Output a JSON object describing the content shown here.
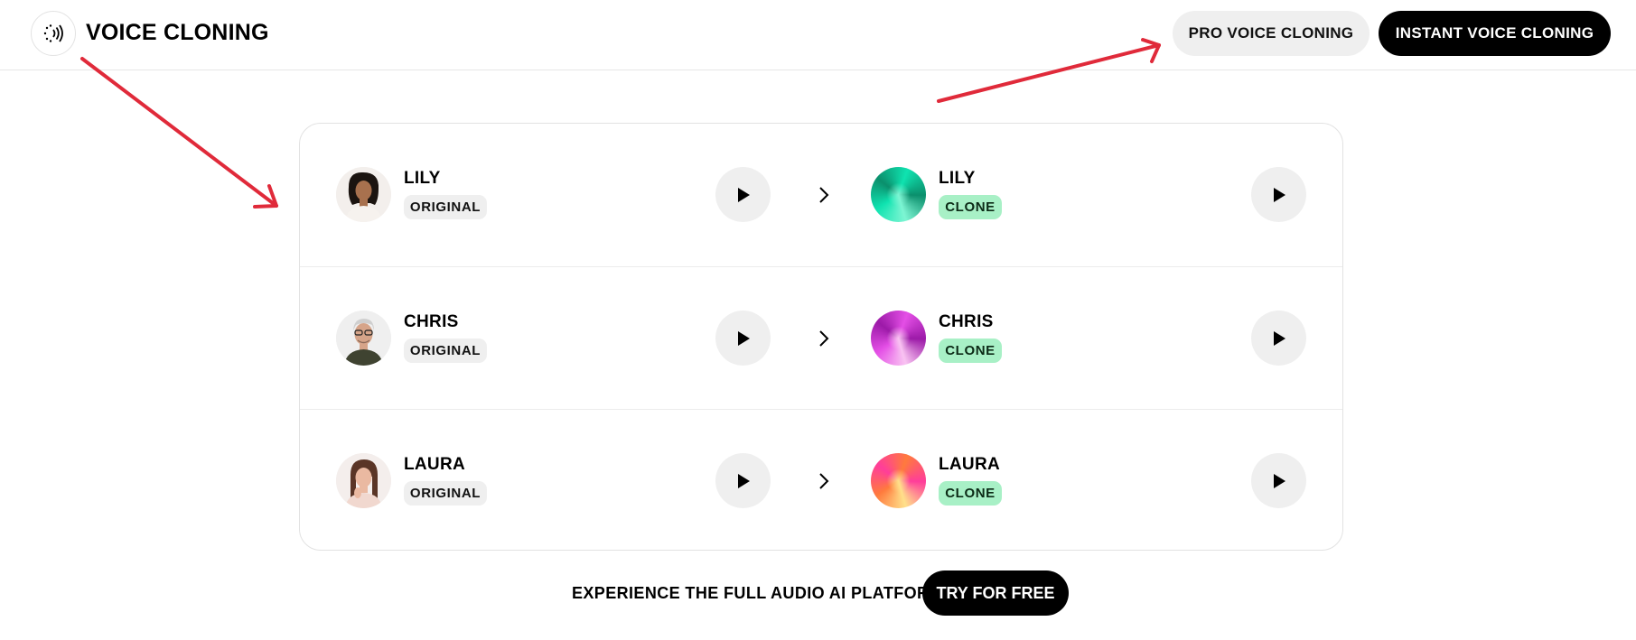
{
  "header": {
    "brand": "VOICE CLONING",
    "logo_icon": "sound-wave-icon",
    "pro_button": "PRO VOICE CLONING",
    "instant_button": "INSTANT VOICE CLONING"
  },
  "voices": [
    {
      "original_name": "LILY",
      "original_tag": "ORIGINAL",
      "clone_name": "LILY",
      "clone_tag": "CLONE",
      "orb_colors": [
        "#0fe3b0",
        "#0b8f6c",
        "#7df5d3"
      ]
    },
    {
      "original_name": "CHRIS",
      "original_tag": "ORIGINAL",
      "clone_name": "CHRIS",
      "clone_tag": "CLONE",
      "orb_colors": [
        "#e44fe6",
        "#9c1aa8",
        "#f9c3f2"
      ]
    },
    {
      "original_name": "LAURA",
      "original_tag": "ORIGINAL",
      "clone_name": "LAURA",
      "clone_tag": "CLONE",
      "orb_colors": [
        "#ff7a3d",
        "#ff3d9a",
        "#ffe08a"
      ]
    }
  ],
  "footer": {
    "cta_text": "EXPERIENCE THE FULL AUDIO AI PLATFORM",
    "try_button": "TRY FOR FREE"
  },
  "colors": {
    "annotation_arrow": "#e02a3a",
    "clone_tag_bg": "#a8f0c6",
    "original_tag_bg": "#efefef"
  }
}
